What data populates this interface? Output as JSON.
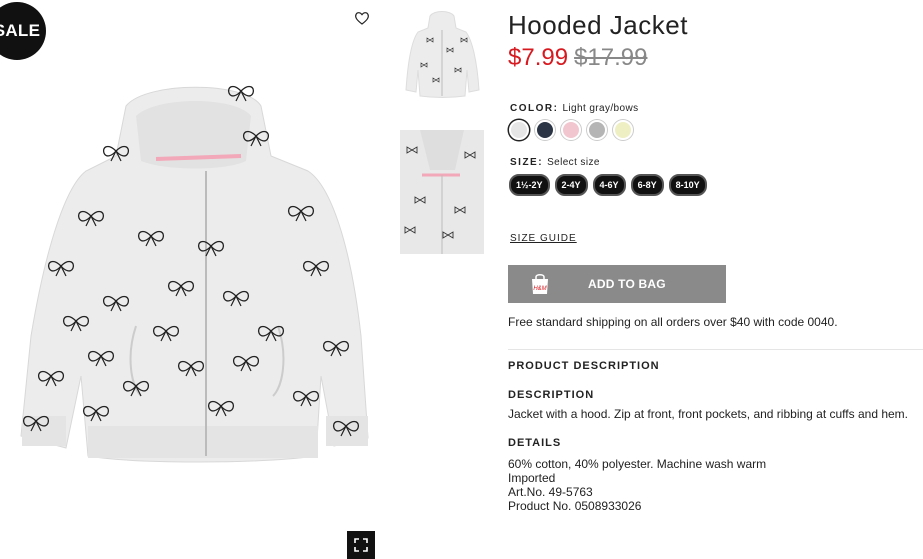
{
  "badge": {
    "sale": "SALE"
  },
  "product": {
    "title": "Hooded Jacket",
    "price_sale": "$7.99",
    "price_original": "$17.99"
  },
  "color": {
    "label": "COLOR:",
    "value": "Light gray/bows",
    "swatches": [
      "#e6e6e6",
      "#2b3444",
      "#f2c6cf",
      "#b5b5b5",
      "#efefc4"
    ]
  },
  "size": {
    "label": "SIZE:",
    "value": "Select size",
    "options": [
      "1½-2Y",
      "2-4Y",
      "4-6Y",
      "6-8Y",
      "8-10Y"
    ]
  },
  "size_guide": "SIZE GUIDE",
  "add_to_bag": {
    "label": "ADD TO BAG",
    "icon_text": "H&M"
  },
  "shipping": "Free standard shipping on all orders over $40 with code 0040.",
  "product_description": {
    "heading": "PRODUCT DESCRIPTION",
    "description_heading": "DESCRIPTION",
    "description": "Jacket with a hood. Zip at front, front pockets, and ribbing at cuffs and hem.",
    "details_heading": "DETAILS",
    "details": [
      "60% cotton, 40% polyester. Machine wash warm",
      "Imported",
      "Art.No. 49-5763",
      "Product No. 0508933026"
    ]
  }
}
